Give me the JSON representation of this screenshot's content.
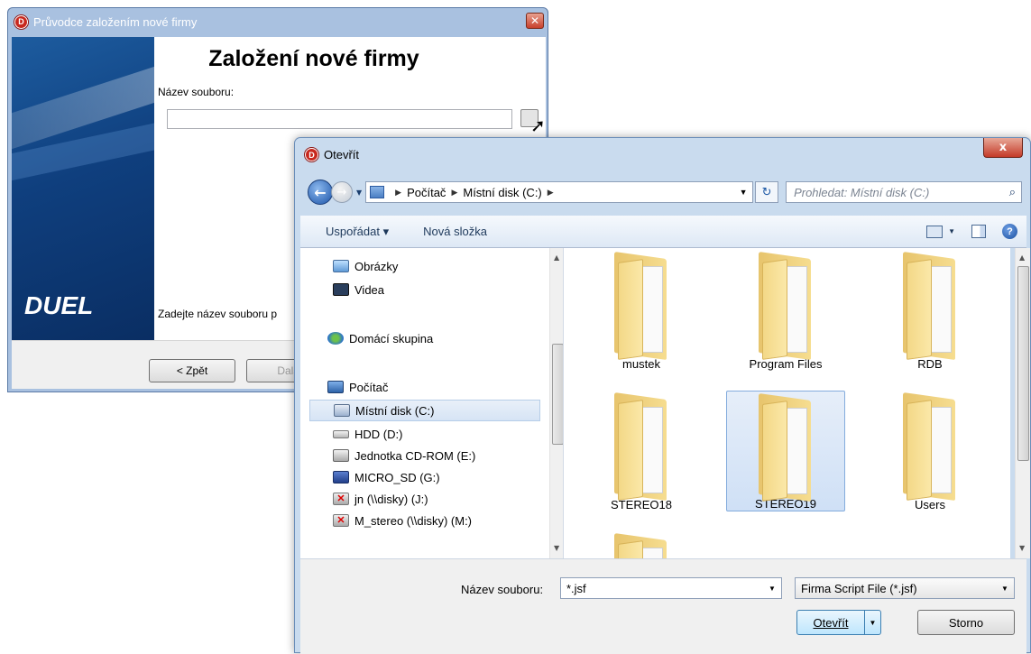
{
  "wizard": {
    "title": "Průvodce založením nové firmy",
    "close_label": "✕",
    "heading": "Založení nové firmy",
    "file_label": "Název souboru:",
    "file_value": "",
    "hint": "Zadejte název souboru p",
    "logo_text": "DUEL",
    "back_label": "< Zpět",
    "next_label": "Další"
  },
  "dialog": {
    "title": "Otevřít",
    "close_label": "x",
    "address": {
      "parts": [
        "Počítač",
        "Místní disk (C:)"
      ]
    },
    "search_placeholder": "Prohledat: Místní disk (C:)",
    "toolbar": {
      "organize": "Uspořádat ▾",
      "new_folder": "Nová složka"
    },
    "nav_items": [
      {
        "label": "Obrázky",
        "icon": "pictures-icon"
      },
      {
        "label": "Videa",
        "icon": "videos-icon"
      },
      {
        "label": "Domácí skupina",
        "icon": "homegroup-icon"
      },
      {
        "label": "Počítač",
        "icon": "computer-icon"
      },
      {
        "label": "Místní disk (C:)",
        "icon": "local-disk-icon",
        "selected": true
      },
      {
        "label": "HDD (D:)",
        "icon": "hdd-icon"
      },
      {
        "label": "Jednotka CD-ROM (E:)",
        "icon": "cdrom-icon"
      },
      {
        "label": "MICRO_SD (G:)",
        "icon": "removable-drive-icon"
      },
      {
        "label": "jn (\\\\disky) (J:)",
        "icon": "network-drive-disconnected-icon"
      },
      {
        "label": "M_stereo (\\\\disky) (M:)",
        "icon": "network-drive-disconnected-icon"
      }
    ],
    "folders": [
      {
        "name": "mustek"
      },
      {
        "name": "Program Files"
      },
      {
        "name": "RDB"
      },
      {
        "name": "STEREO18"
      },
      {
        "name": "STEREO19",
        "selected": true
      },
      {
        "name": "Users"
      }
    ],
    "filename_label": "Název souboru:",
    "filename_value": "*.jsf",
    "filetype_value": "Firma Script File (*.jsf)",
    "open_label": "Otevřít",
    "cancel_label": "Storno"
  },
  "colors": {
    "accent": "#1f5aa6",
    "selection": "#cfe0f6",
    "wizard_side": "#0f3f7e"
  }
}
